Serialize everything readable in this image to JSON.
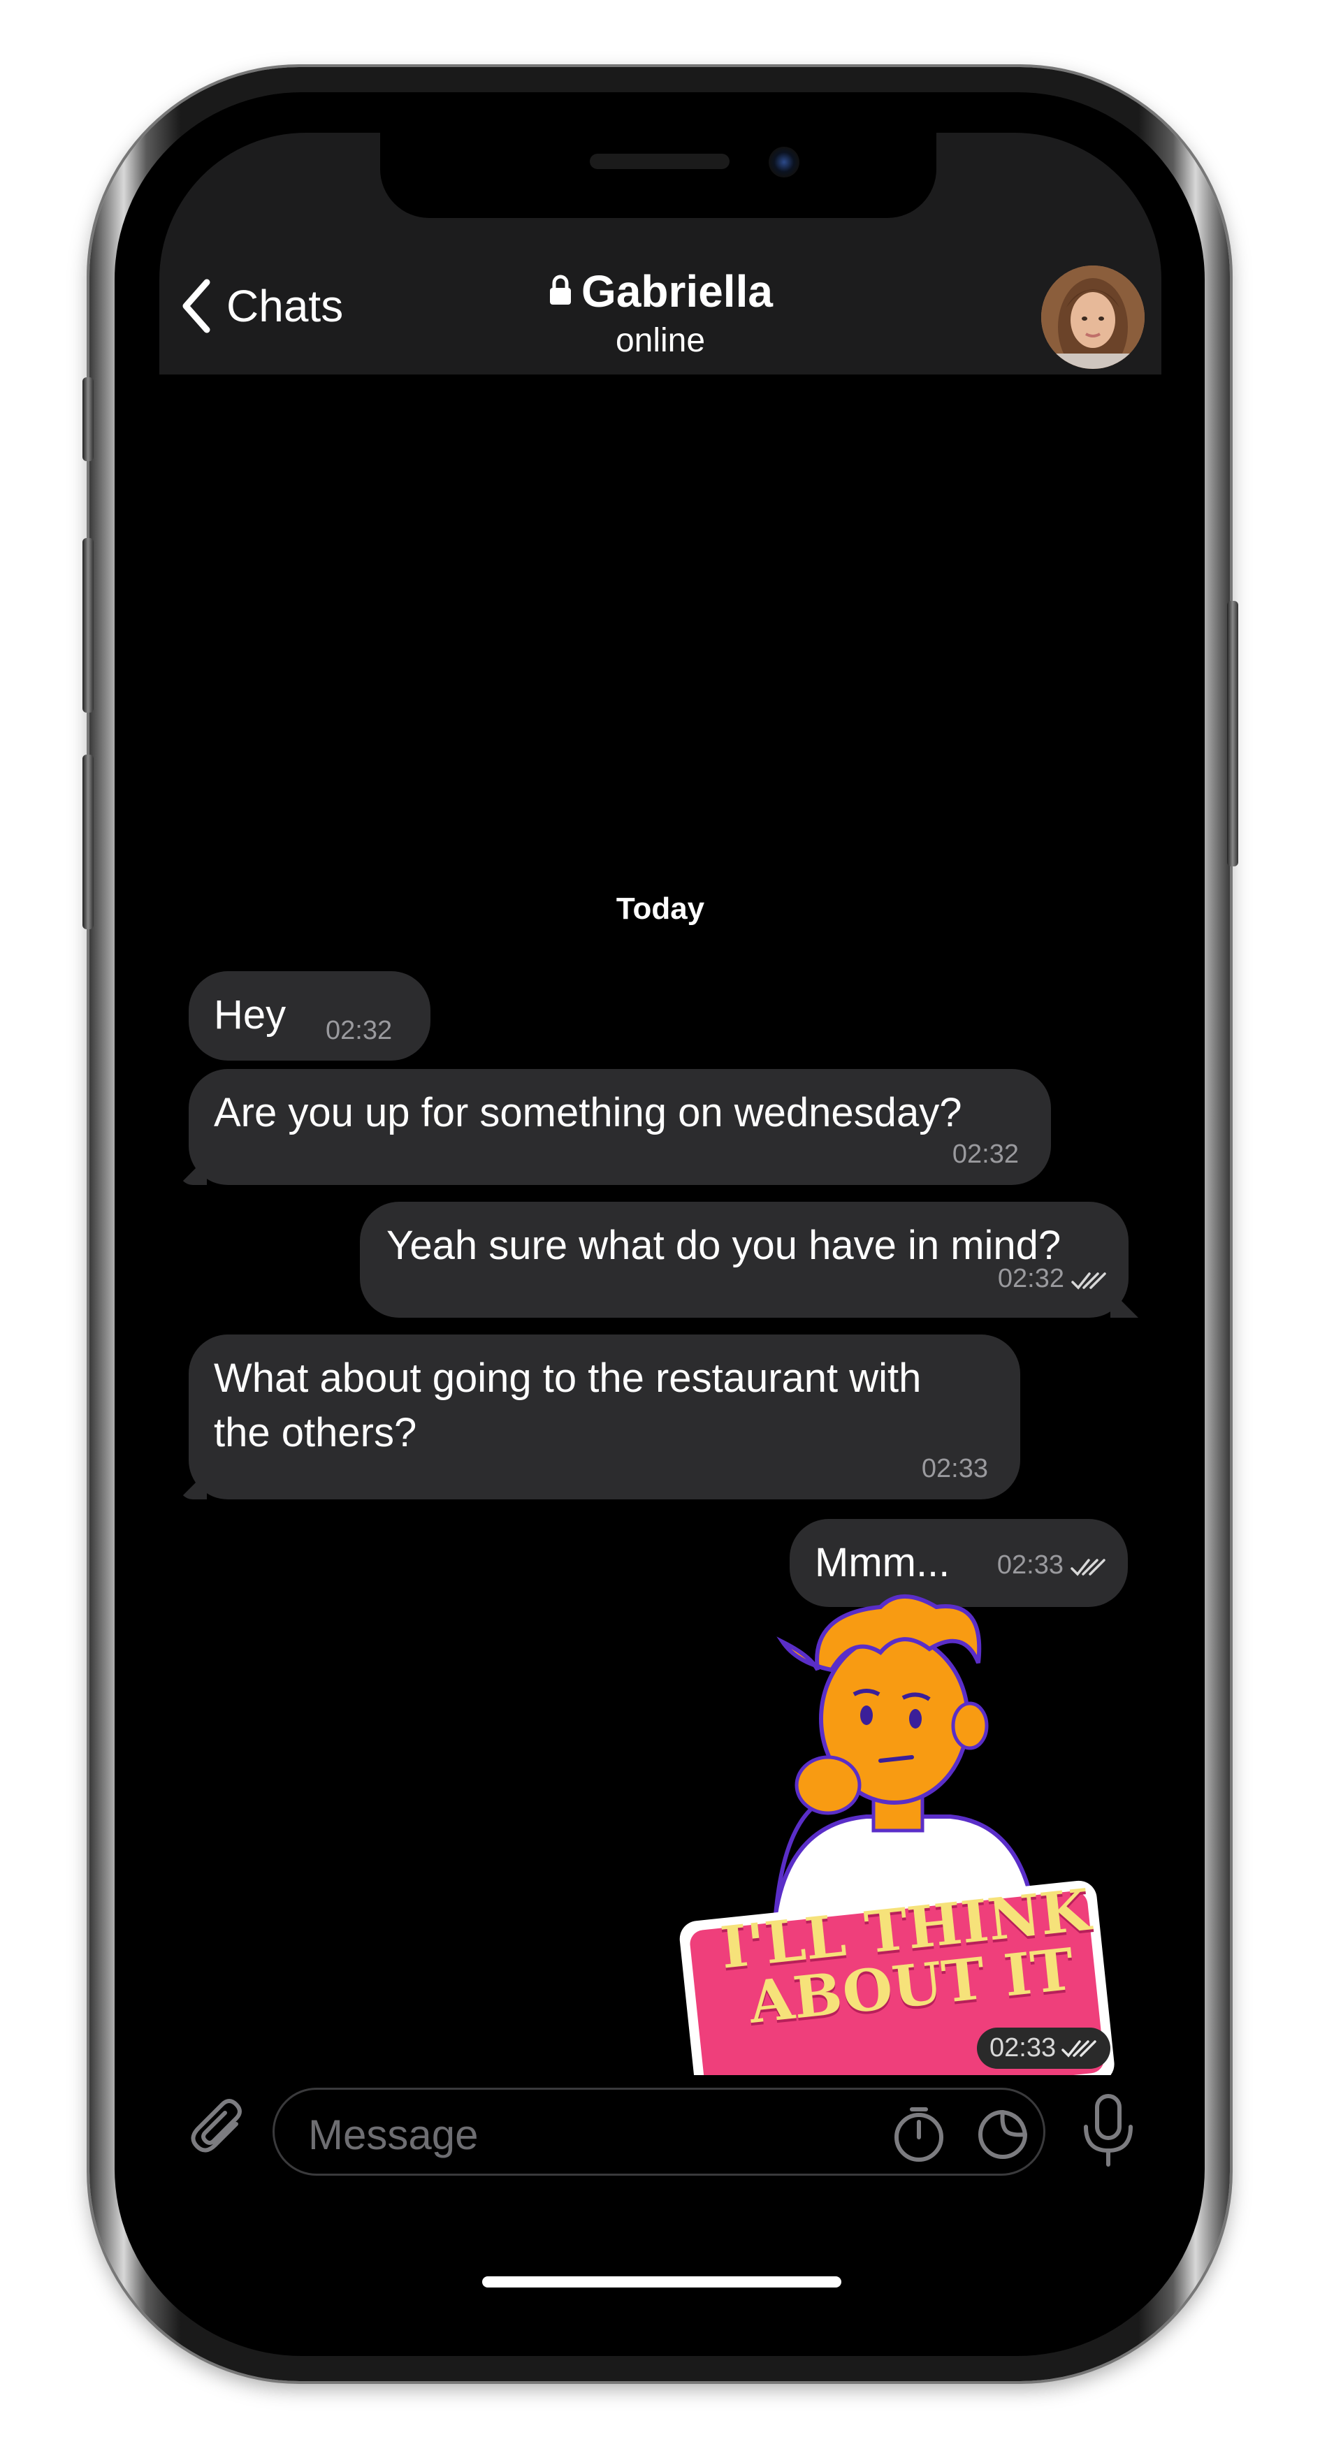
{
  "header": {
    "back_label": "Chats",
    "title": "Gabriella",
    "subtitle": "online"
  },
  "chat": {
    "date_separator": "Today",
    "messages": [
      {
        "dir": "in",
        "text": "Hey",
        "time": "02:32"
      },
      {
        "dir": "in",
        "text": "Are you up for something on wednesday?",
        "time": "02:32"
      },
      {
        "dir": "out",
        "text": "Yeah sure what do you have in mind?",
        "time": "02:32"
      },
      {
        "dir": "in",
        "text": "What about going to the restaurant with the others?",
        "time": "02:33"
      },
      {
        "dir": "out",
        "text": "Mmm...",
        "time": "02:33"
      }
    ],
    "sticker": {
      "text_line1": "I'LL THINK",
      "text_line2": "ABOUT IT",
      "time": "02:33"
    }
  },
  "composer": {
    "placeholder": "Message"
  },
  "colors": {
    "bubble": "#2c2c2e",
    "header_bg": "#1c1c1d",
    "sticker_pink": "#ef3f7b",
    "sticker_yellow": "#f6e27a",
    "sticker_orange": "#f89b12"
  },
  "icons": [
    "back-chevron-icon",
    "lock-icon",
    "paperclip-icon",
    "timer-icon",
    "sticker-icon",
    "microphone-icon",
    "double-check-icon"
  ]
}
